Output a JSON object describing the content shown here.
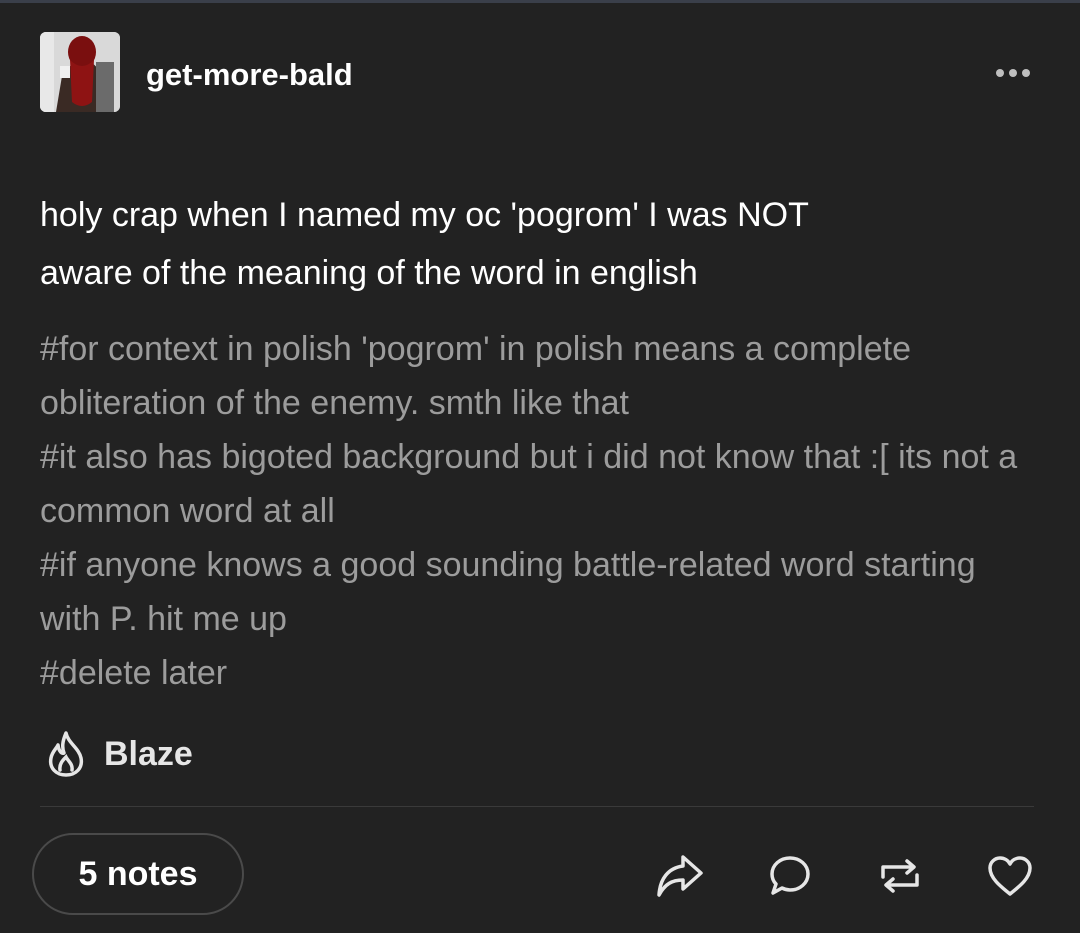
{
  "post": {
    "username": "get-more-bald",
    "body_lines": [
      "holy crap when I named my oc 'pogrom' I was NOT",
      "aware of the meaning of the word in english"
    ],
    "tags": [
      "#for context in polish 'pogrom' in polish means a complete obliteration of the enemy. smth like that",
      "#it also has bigoted background but i did not know that :[ its not a common word at all",
      "#if anyone knows a good sounding battle-related word starting with P. hit me up",
      "#delete later"
    ]
  },
  "footer": {
    "blaze_label": "Blaze",
    "notes_label": "5 notes"
  },
  "icons": {
    "more": "more-dots-icon",
    "blaze": "flame-icon",
    "share": "share-icon",
    "reply": "reply-bubble-icon",
    "reblog": "reblog-icon",
    "like": "heart-icon"
  },
  "colors": {
    "background": "#222222",
    "text": "#ffffff",
    "tags": "#9c9c9c"
  }
}
